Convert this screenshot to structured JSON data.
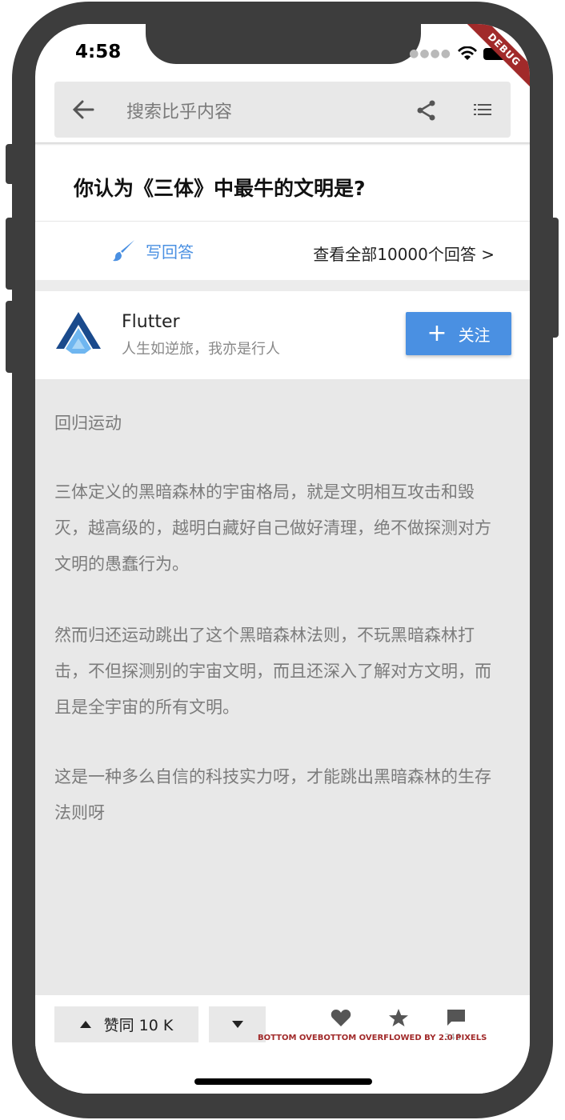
{
  "status_bar": {
    "time": "4:58"
  },
  "debug_banner": "DEBUG",
  "search": {
    "placeholder": "搜索比乎内容"
  },
  "question": {
    "title": "你认为《三体》中最牛的文明是?"
  },
  "answer_actions": {
    "write_label": "写回答",
    "view_all_label": "查看全部10000个回答 >"
  },
  "author": {
    "name": "Flutter",
    "bio": "人生如逆旅，我亦是行人",
    "follow_label": "关注"
  },
  "content": {
    "paragraphs": [
      "回归运动",
      "三体定义的黑暗森林的宇宙格局，就是文明相互攻击和毁灭，越高级的，越明白藏好自己做好清理，绝不做探测对方文明的愚蠢行为。",
      "然而归还运动跳出了这个黑暗森林法则，不玩黑暗森林打击，不但探测别的宇宙文明，而且还深入了解对方文明，而且是全宇宙的所有文明。",
      "这是一种多么自信的科技实力呀，才能跳出黑暗森林的生存法则呀"
    ]
  },
  "bottom_bar": {
    "upvote_label": "赞同 10 K",
    "comment_count": "346",
    "overflow_warning": "BOTTOM OVEBOTTOM OVERFLOWED BY 2.0 PIXELS"
  },
  "colors": {
    "accent": "#4a90e2",
    "debug": "#a12a2a",
    "content_bg": "#e8e8e8"
  }
}
